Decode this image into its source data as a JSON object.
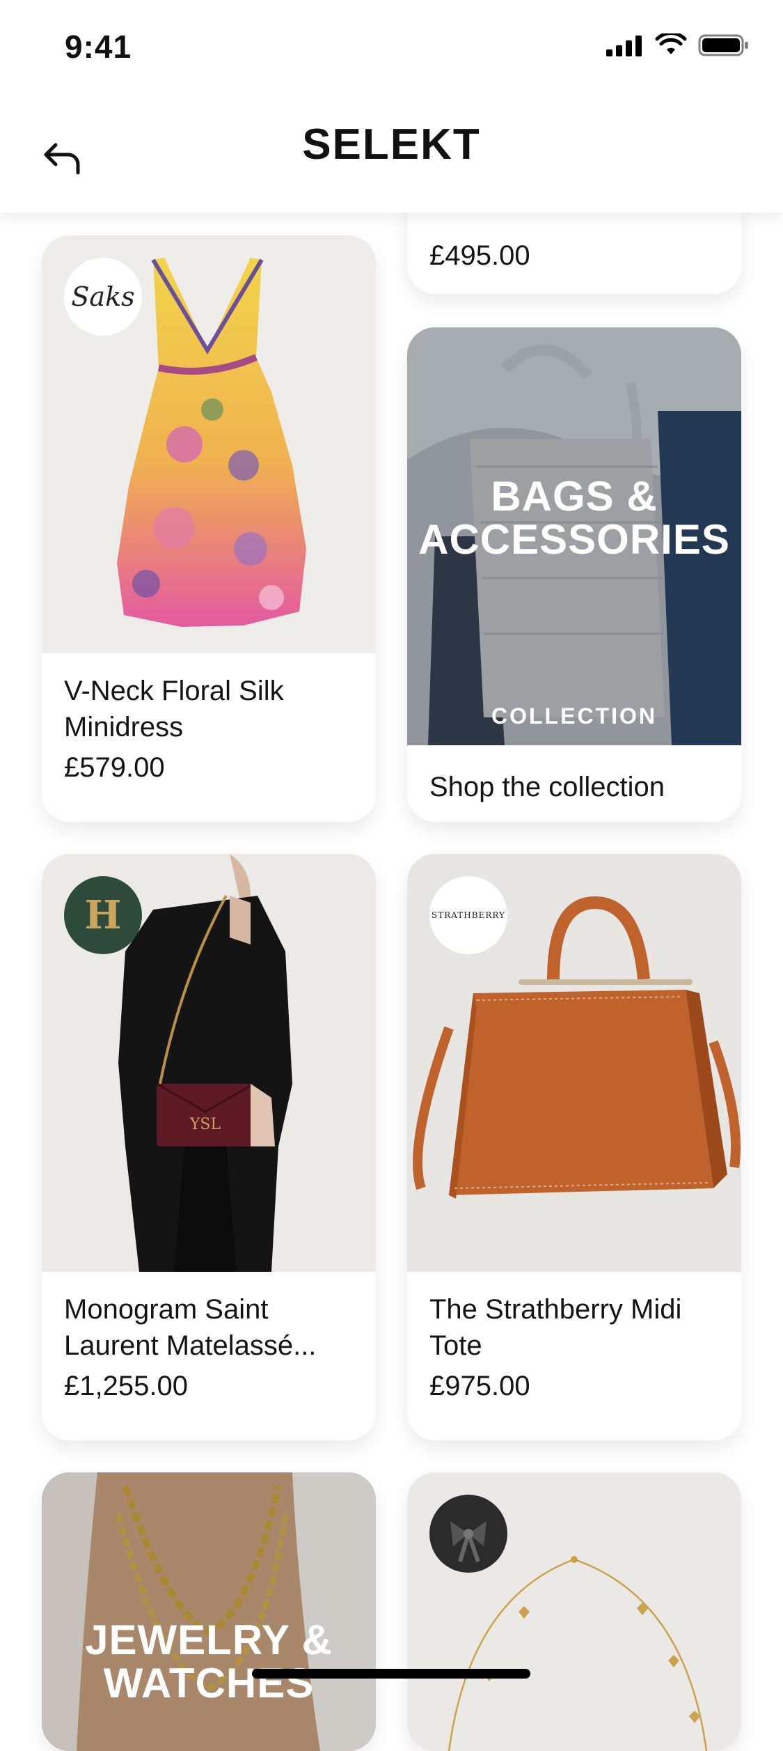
{
  "status": {
    "time": "9:41"
  },
  "header": {
    "title": "SELEKT"
  },
  "top_partial": {
    "price": "£495.00"
  },
  "products": [
    {
      "name": "V-Neck Floral Silk Minidress",
      "price": "£579.00",
      "brand_logo": "Saks"
    },
    {
      "name": "Monogram Saint Laurent Matelassé...",
      "price": "£1,255.00",
      "brand_logo": "H"
    },
    {
      "name": "The Strathberry Midi Tote",
      "price": "£975.00",
      "brand_logo": "STRATHBERRY"
    }
  ],
  "collections": [
    {
      "title_line1": "BAGS &",
      "title_line2": "ACCESSORIES",
      "subtitle": "COLLECTION",
      "cta": "Shop the collection"
    },
    {
      "title_line1": "JEWELRY &",
      "title_line2": "WATCHES"
    }
  ],
  "icons": [
    "signal-icon",
    "wifi-icon",
    "battery-icon",
    "back-arrow-icon"
  ],
  "colors": {
    "background": "#ffffff",
    "card_image_bg": "#efedea",
    "accent_green": "#2d4a3a",
    "leather_tan": "#c0622b"
  }
}
